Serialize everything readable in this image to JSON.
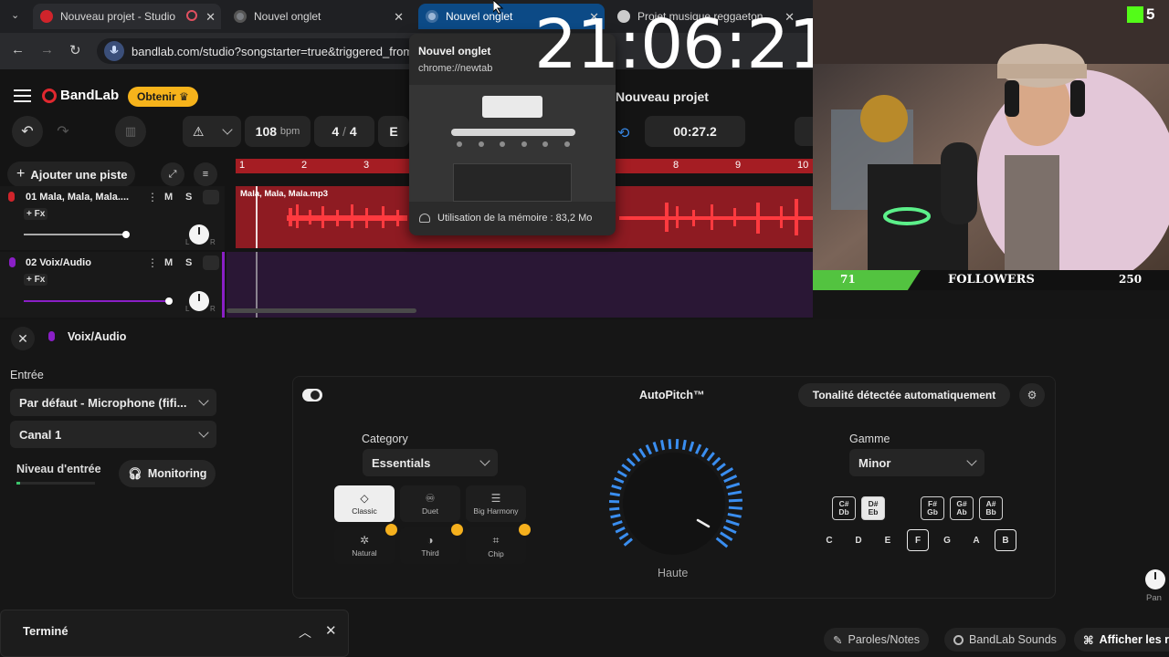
{
  "browser": {
    "tabs": [
      {
        "label": "Nouveau projet - Studio",
        "active": false
      },
      {
        "label": "Nouvel onglet",
        "active": false
      },
      {
        "label": "Nouvel onglet",
        "active": true
      },
      {
        "label": "Projet musique reggaeton",
        "active": false
      }
    ],
    "url": "bandlab.com/studio?songstarter=true&triggered_from="
  },
  "tooltip": {
    "title": "Nouvel onglet",
    "url": "chrome://newtab",
    "memory": "Utilisation de la mémoire : 83,2 Mo"
  },
  "app": {
    "logo": "BandLab",
    "obtenir": "Obtenir",
    "project_title": "Nouveau projet",
    "bpm_value": "108",
    "bpm_unit": "bpm",
    "time_sig_num": "4",
    "time_sig_sep": "/",
    "time_sig_den": "4",
    "key_partial": "E",
    "time_display": "00:27.2",
    "add_track": "Ajouter une piste",
    "ruler": [
      "1",
      "2",
      "3",
      "8",
      "9",
      "10"
    ],
    "tracks": [
      {
        "name": "01 Mala, Mala, Mala....",
        "fx": "+ Fx",
        "mute": "M",
        "solo": "S",
        "clip": "Mala, Mala, Mala.mp3"
      },
      {
        "name": "02 Voix/Audio",
        "fx": "+ Fx",
        "mute": "M",
        "solo": "S"
      }
    ],
    "knob_l": "L",
    "knob_r": "R"
  },
  "panel": {
    "title": "Voix/Audio",
    "entree_label": "Entrée",
    "input_device": "Par défaut - Microphone (fifi...",
    "channel": "Canal 1",
    "niveau_label": "Niveau d'entrée",
    "monitoring": "Monitoring",
    "autopitch_title": "AutoPitch™",
    "detect_key": "Tonalité détectée automatiquement",
    "category_label": "Category",
    "category_value": "Essentials",
    "presets": [
      "Classic",
      "Duet",
      "Big Harmony",
      "Natural",
      "Third",
      "Chip"
    ],
    "knob_label": "Haute",
    "gamme_label": "Gamme",
    "gamme_value": "Minor",
    "sharps": [
      {
        "top": "C#",
        "bot": "Db"
      },
      {
        "top": "D#",
        "bot": "Eb"
      },
      {
        "top": "F#",
        "bot": "Gb"
      },
      {
        "top": "G#",
        "bot": "Ab"
      },
      {
        "top": "A#",
        "bot": "Bb"
      }
    ],
    "naturals": [
      "C",
      "D",
      "E",
      "F",
      "G",
      "A",
      "B"
    ],
    "pan_label": "Pan"
  },
  "notification": {
    "label": "Terminé"
  },
  "bottom_bar": {
    "lyrics": "Paroles/Notes",
    "sounds": "BandLab Sounds",
    "show": "Afficher les r"
  },
  "overlay": {
    "clock": "21:06:21",
    "kick_count": "5",
    "followers_current": "71",
    "followers_label": "FOLLOWERS",
    "followers_goal": "250"
  },
  "colors": {
    "accent_red": "#c8222a",
    "accent_purple": "#8a1fc6",
    "chrome_active_tab": "#0c4a86",
    "obtenir_yellow": "#f6b31b",
    "knob_blue": "#3a8ef0",
    "followers_green": "#53c340"
  }
}
